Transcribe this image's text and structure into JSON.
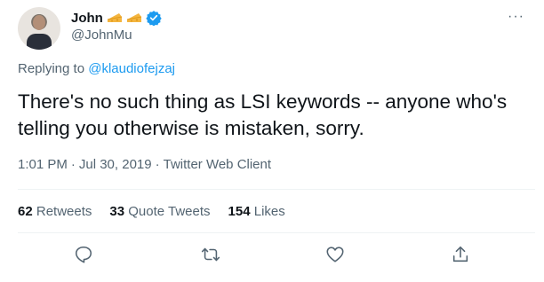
{
  "author": {
    "name": "John",
    "handle": "@JohnMu",
    "badges": [
      "cheese-icon",
      "cheese-icon",
      "verified-icon"
    ]
  },
  "replying": {
    "prefix": "Replying to",
    "target": "@klaudiofejzaj"
  },
  "tweet": {
    "text": "There's no such thing as LSI keywords -- anyone who's telling you otherwise is mistaken, sorry.",
    "time": "1:01 PM",
    "separator1": "·",
    "date": "Jul 30, 2019",
    "separator2": "·",
    "client": "Twitter Web Client"
  },
  "stats": [
    {
      "count": "62",
      "label": "Retweets"
    },
    {
      "count": "33",
      "label": "Quote Tweets"
    },
    {
      "count": "154",
      "label": "Likes"
    }
  ],
  "actions": [
    {
      "icon": "reply-icon"
    },
    {
      "icon": "retweet-icon"
    },
    {
      "icon": "like-icon"
    },
    {
      "icon": "share-icon"
    }
  ],
  "colors": {
    "link": "#1d9bf0",
    "secondary": "#536471",
    "primary": "#0f1419",
    "cheese": "#f4b53f"
  }
}
